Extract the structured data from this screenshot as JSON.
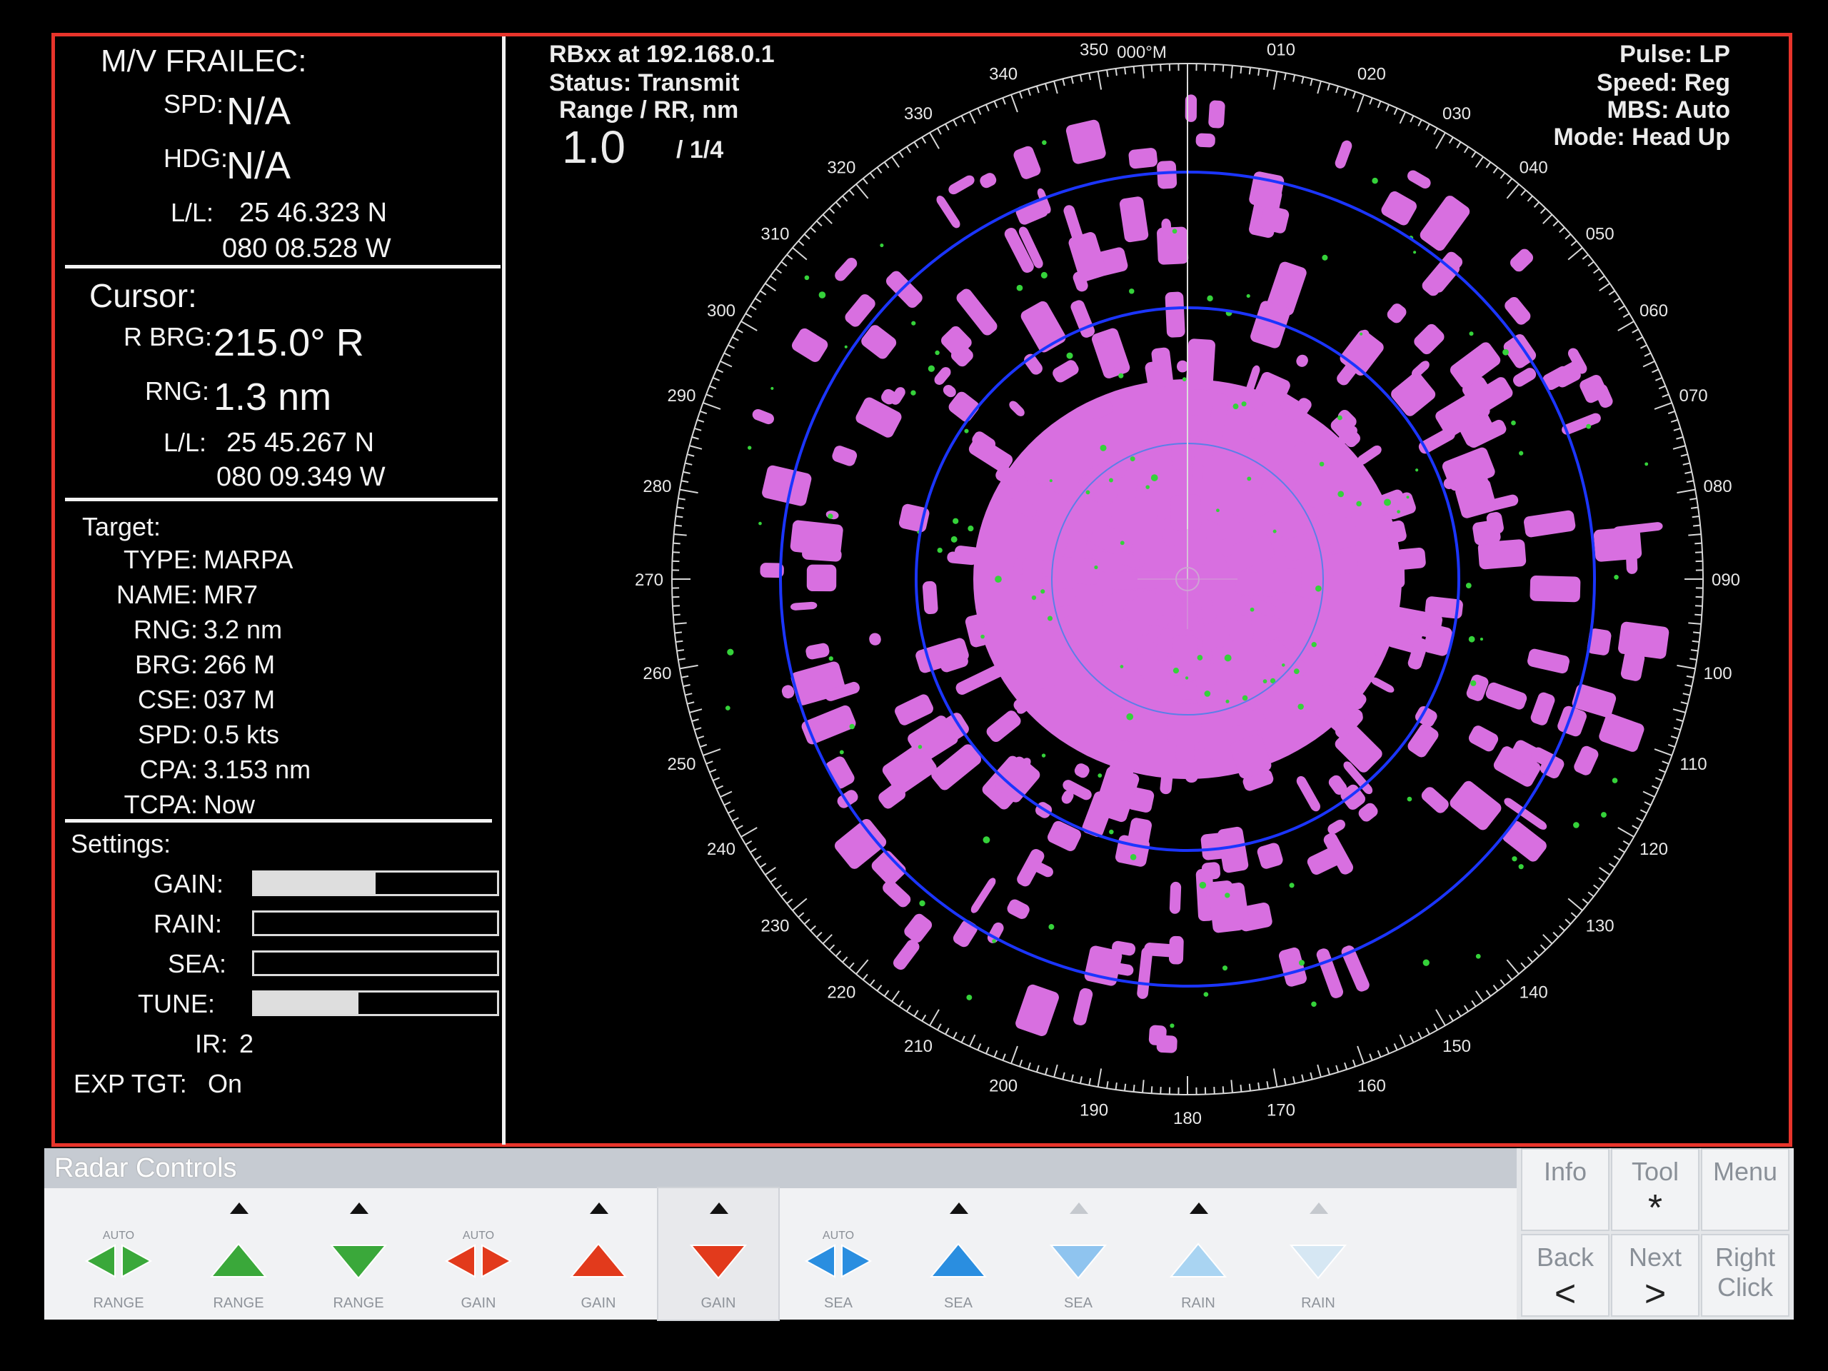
{
  "vessel": {
    "name": "M/V FRAILEC:",
    "spd_label": "SPD:",
    "spd_value": "N/A",
    "hdg_label": "HDG:",
    "hdg_value": "N/A",
    "ll_label": "L/L:",
    "lat": "25 46.323 N",
    "lon": "080 08.528 W"
  },
  "cursor": {
    "title": "Cursor:",
    "rbrg_label": "R BRG:",
    "rbrg_value": "215.0° R",
    "rng_label": "RNG:",
    "rng_value": "1.3 nm",
    "ll_label": "L/L:",
    "lat": "25 45.267 N",
    "lon": "080 09.349 W"
  },
  "target": {
    "title": "Target:",
    "rows": [
      {
        "label": "TYPE:",
        "value": "MARPA"
      },
      {
        "label": "NAME:",
        "value": "MR7"
      },
      {
        "label": "RNG:",
        "value": "3.2 nm"
      },
      {
        "label": "BRG:",
        "value": "266 M"
      },
      {
        "label": "CSE:",
        "value": "037 M"
      },
      {
        "label": "SPD:",
        "value": "0.5 kts"
      },
      {
        "label": "CPA:",
        "value": "3.153 nm"
      },
      {
        "label": "TCPA:",
        "value": "Now"
      }
    ]
  },
  "settings": {
    "title": "Settings:",
    "gain_label": "GAIN:",
    "gain_level": 0.5,
    "rain_label": "RAIN:",
    "rain_level": 0.0,
    "sea_label": "SEA:",
    "sea_level": 0.0,
    "tune_label": "TUNE:",
    "tune_level": 0.43,
    "ir_label": "IR:",
    "ir_value": "2",
    "exp_label": "EXP TGT:",
    "exp_value": "On"
  },
  "radar": {
    "device": "RBxx at 192.168.0.1",
    "status": "Status:  Transmit",
    "range_label": "Range / RR, nm",
    "range_value": "1.0",
    "ring_value": "/ 1/4",
    "pulse": "Pulse:  LP",
    "speed": "Speed:  Reg",
    "mbs": "MBS:  Auto",
    "mode": "Mode:  Head Up",
    "heading_tick": "000°M",
    "bearing_labels": [
      "010",
      "020",
      "030",
      "040",
      "050",
      "060",
      "070",
      "080",
      "090",
      "100",
      "110",
      "120",
      "130",
      "140",
      "150",
      "160",
      "170",
      "180",
      "190",
      "200",
      "210",
      "220",
      "230",
      "240",
      "250",
      "260",
      "270",
      "280",
      "290",
      "300",
      "310",
      "320",
      "330",
      "340",
      "350"
    ]
  },
  "controls": {
    "title": "Radar Controls",
    "auto_text": "AUTO",
    "buttons": [
      {
        "cap": "RANGE",
        "auto": true
      },
      {
        "cap": "RANGE",
        "auto": false
      },
      {
        "cap": "RANGE",
        "auto": false
      },
      {
        "cap": "GAIN",
        "auto": true
      },
      {
        "cap": "GAIN",
        "auto": false
      },
      {
        "cap": "GAIN",
        "auto": false
      },
      {
        "cap": "SEA",
        "auto": true
      },
      {
        "cap": "SEA",
        "auto": false
      },
      {
        "cap": "SEA",
        "auto": false
      },
      {
        "cap": "RAIN",
        "auto": false
      },
      {
        "cap": "RAIN",
        "auto": false
      }
    ],
    "colors": {
      "range": "#3aa83a",
      "gain": "#e23a1c",
      "sea": "#2a8ee0",
      "sea_dim": "#8fc4ef",
      "rain": "#a9d4f2",
      "rain_dim": "#d6e7f3"
    }
  },
  "nav": {
    "info": "Info",
    "tool": "Tool",
    "tool_symbol": "*",
    "menu": "Menu",
    "back": "Back",
    "back_symbol": "<",
    "next": "Next",
    "next_symbol": ">",
    "right": "Right",
    "click": "Click"
  }
}
